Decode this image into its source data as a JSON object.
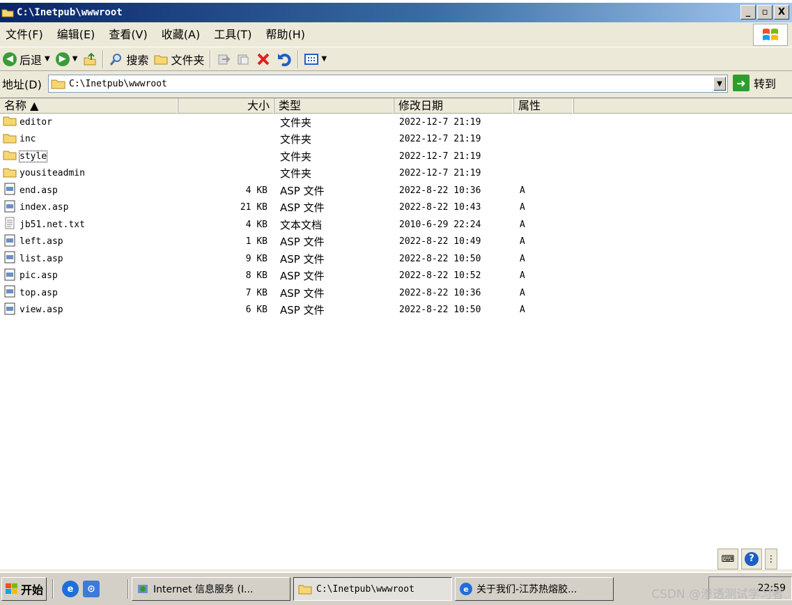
{
  "window": {
    "title": "C:\\Inetpub\\wwwroot",
    "minimize": "_",
    "maximize": "▫",
    "close": "X"
  },
  "menu": [
    "文件(F)",
    "编辑(E)",
    "查看(V)",
    "收藏(A)",
    "工具(T)",
    "帮助(H)"
  ],
  "toolbar": {
    "back": "后退",
    "search": "搜索",
    "folders": "文件夹"
  },
  "address": {
    "label": "地址(D)",
    "value": "C:\\Inetpub\\wwwroot",
    "go": "转到"
  },
  "columns": {
    "name": "名称 ▲",
    "size": "大小",
    "type": "类型",
    "modified": "修改日期",
    "attributes": "属性"
  },
  "files": [
    {
      "name": "editor",
      "size": "",
      "type": "文件夹",
      "date": "2022-12-7 21:19",
      "attr": "",
      "icon": "folder"
    },
    {
      "name": "inc",
      "size": "",
      "type": "文件夹",
      "date": "2022-12-7 21:19",
      "attr": "",
      "icon": "folder"
    },
    {
      "name": "style",
      "size": "",
      "type": "文件夹",
      "date": "2022-12-7 21:19",
      "attr": "",
      "icon": "folder"
    },
    {
      "name": "yousiteadmin",
      "size": "",
      "type": "文件夹",
      "date": "2022-12-7 21:19",
      "attr": "",
      "icon": "folder"
    },
    {
      "name": "end.asp",
      "size": "4 KB",
      "type": "ASP 文件",
      "date": "2022-8-22 10:36",
      "attr": "A",
      "icon": "asp"
    },
    {
      "name": "index.asp",
      "size": "21 KB",
      "type": "ASP 文件",
      "date": "2022-8-22 10:43",
      "attr": "A",
      "icon": "asp"
    },
    {
      "name": "jb51.net.txt",
      "size": "4 KB",
      "type": "文本文档",
      "date": "2010-6-29 22:24",
      "attr": "A",
      "icon": "txt"
    },
    {
      "name": "left.asp",
      "size": "1 KB",
      "type": "ASP 文件",
      "date": "2022-8-22 10:49",
      "attr": "A",
      "icon": "asp"
    },
    {
      "name": "list.asp",
      "size": "9 KB",
      "type": "ASP 文件",
      "date": "2022-8-22 10:50",
      "attr": "A",
      "icon": "asp"
    },
    {
      "name": "pic.asp",
      "size": "8 KB",
      "type": "ASP 文件",
      "date": "2022-8-22 10:52",
      "attr": "A",
      "icon": "asp"
    },
    {
      "name": "top.asp",
      "size": "7 KB",
      "type": "ASP 文件",
      "date": "2022-8-22 10:36",
      "attr": "A",
      "icon": "asp"
    },
    {
      "name": "view.asp",
      "size": "6 KB",
      "type": "ASP 文件",
      "date": "2022-8-22 10:50",
      "attr": "A",
      "icon": "asp"
    }
  ],
  "taskbar": {
    "start": "开始",
    "tasks": [
      "Internet 信息服务 (I...",
      "C:\\Inetpub\\wwwroot",
      "关于我们-江苏热熔胶..."
    ],
    "clock": "22:59",
    "watermark": "CSDN @渗透测试学习者"
  }
}
